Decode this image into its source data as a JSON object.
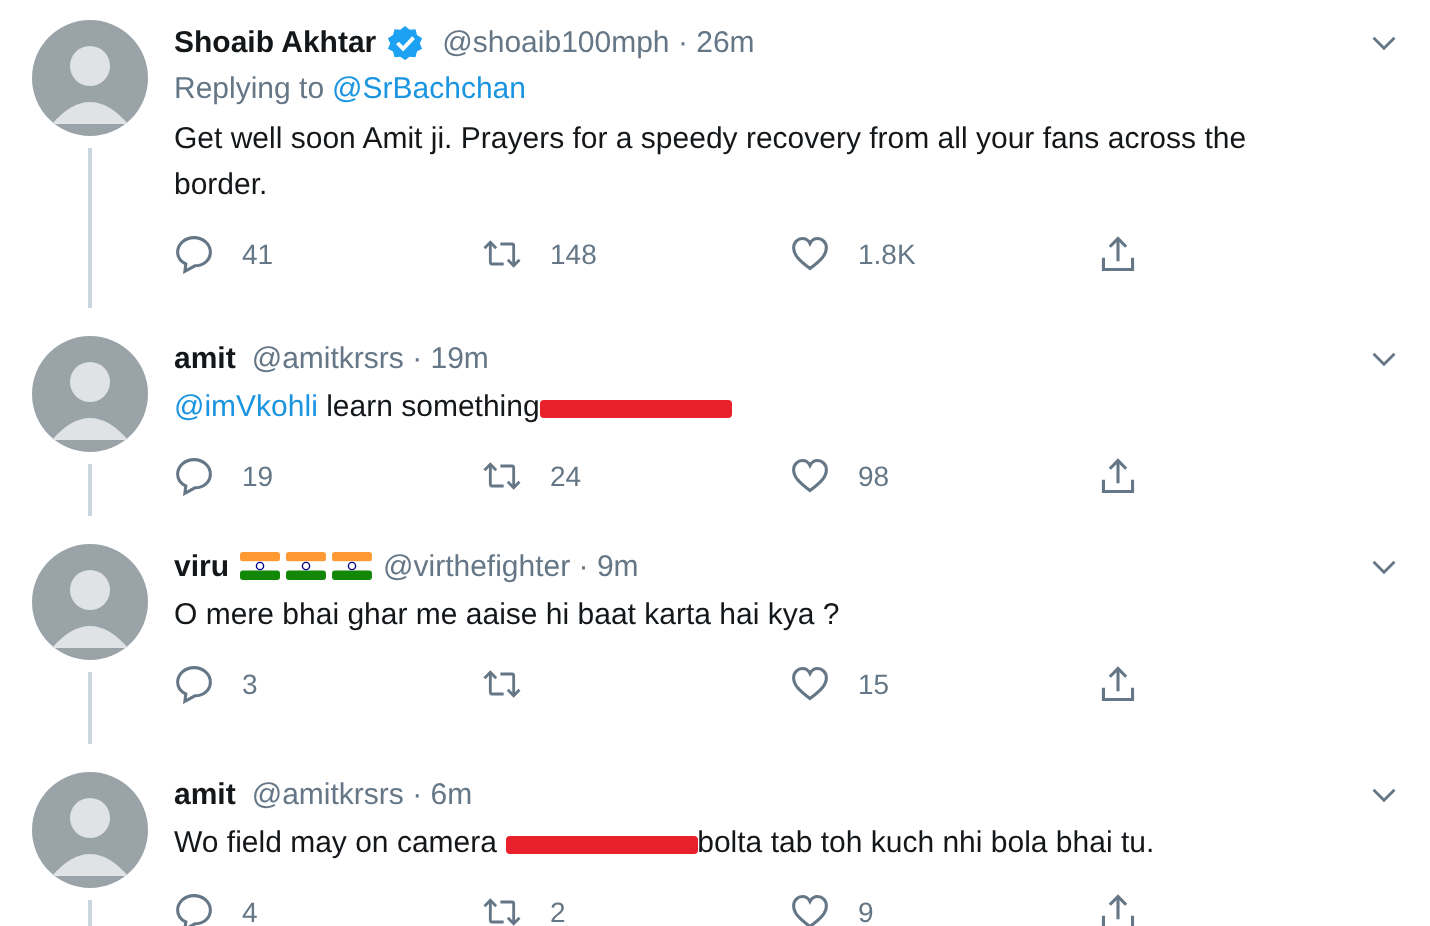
{
  "tweets": [
    {
      "name": "Shoaib Akhtar",
      "verified": true,
      "meta": "@shoaib100mph · 26m",
      "replying_label": "Replying to",
      "replying_to": "@SrBachchan",
      "text": [
        {
          "kind": "text",
          "text": "Get well soon Amit ji. Prayers for a speedy recovery from all your fans across the border."
        }
      ],
      "actions": [
        {
          "kind": "reply",
          "count": "41"
        },
        {
          "kind": "retweet",
          "count": "148"
        },
        {
          "kind": "like",
          "count": "1.8K"
        },
        {
          "kind": "share"
        }
      ]
    },
    {
      "name": "amit",
      "verified": false,
      "meta": "@amitkrsrs · 19m",
      "text": [
        {
          "kind": "mention",
          "text": "@imVkohli"
        },
        {
          "kind": "text",
          "text": " learn something"
        },
        {
          "kind": "redacted"
        }
      ],
      "actions": [
        {
          "kind": "reply",
          "count": "19"
        },
        {
          "kind": "retweet",
          "count": "24"
        },
        {
          "kind": "like",
          "count": "98"
        },
        {
          "kind": "share"
        }
      ]
    },
    {
      "name": "viru",
      "verified": false,
      "name_icons": [
        {
          "kind": "flag"
        },
        {
          "kind": "flag"
        },
        {
          "kind": "flag"
        }
      ],
      "meta": "@virthefighter · 9m",
      "text": [
        {
          "kind": "text",
          "text": "O mere bhai ghar me aaise hi baat karta hai kya ?"
        }
      ],
      "actions": [
        {
          "kind": "reply",
          "count": "3"
        },
        {
          "kind": "retweet"
        },
        {
          "kind": "like",
          "count": "15"
        },
        {
          "kind": "share"
        }
      ]
    },
    {
      "name": "amit",
      "verified": false,
      "meta": "@amitkrsrs · 6m",
      "text": [
        {
          "kind": "text",
          "text": "Wo field may on camera "
        },
        {
          "kind": "redacted"
        },
        {
          "kind": "text",
          "text": "bolta tab toh kuch nhi bola bhai tu."
        }
      ],
      "actions": [
        {
          "kind": "reply",
          "count": "4"
        },
        {
          "kind": "retweet",
          "count": "2"
        },
        {
          "kind": "like",
          "count": "9"
        },
        {
          "kind": "share"
        }
      ]
    }
  ]
}
